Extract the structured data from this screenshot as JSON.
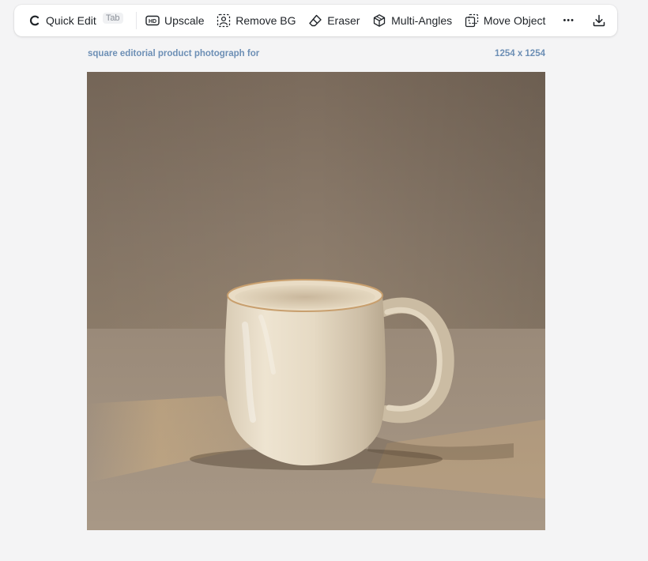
{
  "toolbar": {
    "quick_edit": {
      "label": "Quick Edit",
      "shortcut": "Tab",
      "icon": "c-spinner-icon"
    },
    "upscale": {
      "label": "Upscale",
      "icon": "hd-icon"
    },
    "remove_bg": {
      "label": "Remove BG",
      "icon": "remove-bg-icon"
    },
    "eraser": {
      "label": "Eraser",
      "icon": "eraser-icon"
    },
    "multi_angles": {
      "label": "Multi-Angles",
      "icon": "cube-icon"
    },
    "move_object": {
      "label": "Move Object",
      "icon": "move-object-icon"
    },
    "more": {
      "label": "•••",
      "icon": "more-icon"
    },
    "download": {
      "icon": "download-icon"
    }
  },
  "image": {
    "caption": "square editorial product photograph for",
    "dimensions": "1254 x 1254",
    "subject": "ceramic mug"
  },
  "colors": {
    "caption_text": "#6d8fb5",
    "background": "#f4f4f5"
  }
}
